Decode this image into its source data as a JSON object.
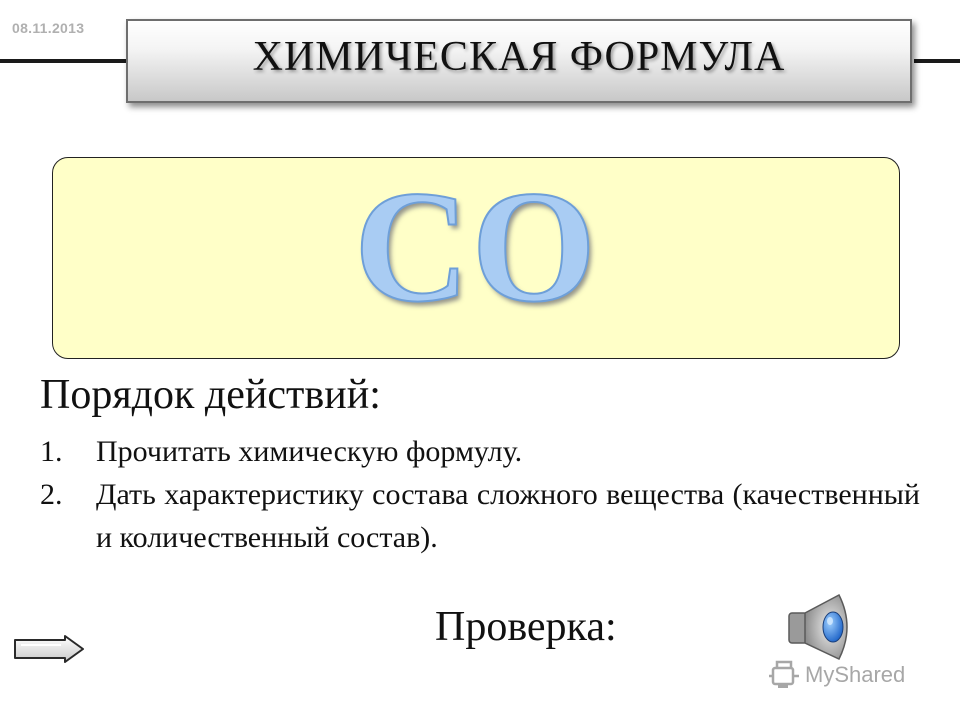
{
  "slide": {
    "date": "08.11.2013",
    "title": "ХИМИЧЕСКАЯ ФОРМУЛА",
    "formula": "CO",
    "section_heading": "Порядок действий:",
    "steps": [
      {
        "number": "1.",
        "text": "Прочитать химическую формулу."
      },
      {
        "number": "2.",
        "text": "Дать характеристику состава сложного вещества (качественный и количественный состав)."
      }
    ],
    "check_label": "Проверка:"
  },
  "watermark": {
    "text": "MyShared"
  },
  "colors": {
    "formula_fill": "#a9ccf3",
    "formula_outline": "#6e9fd8",
    "formula_box_bg": "#ffffc8",
    "title_bar_border": "#6e6e6e",
    "date_text": "#b0b0b0"
  },
  "icons": {
    "next": "arrow-right-icon",
    "audio": "speaker-icon",
    "watermark_logo": "myshared-logo-icon"
  }
}
